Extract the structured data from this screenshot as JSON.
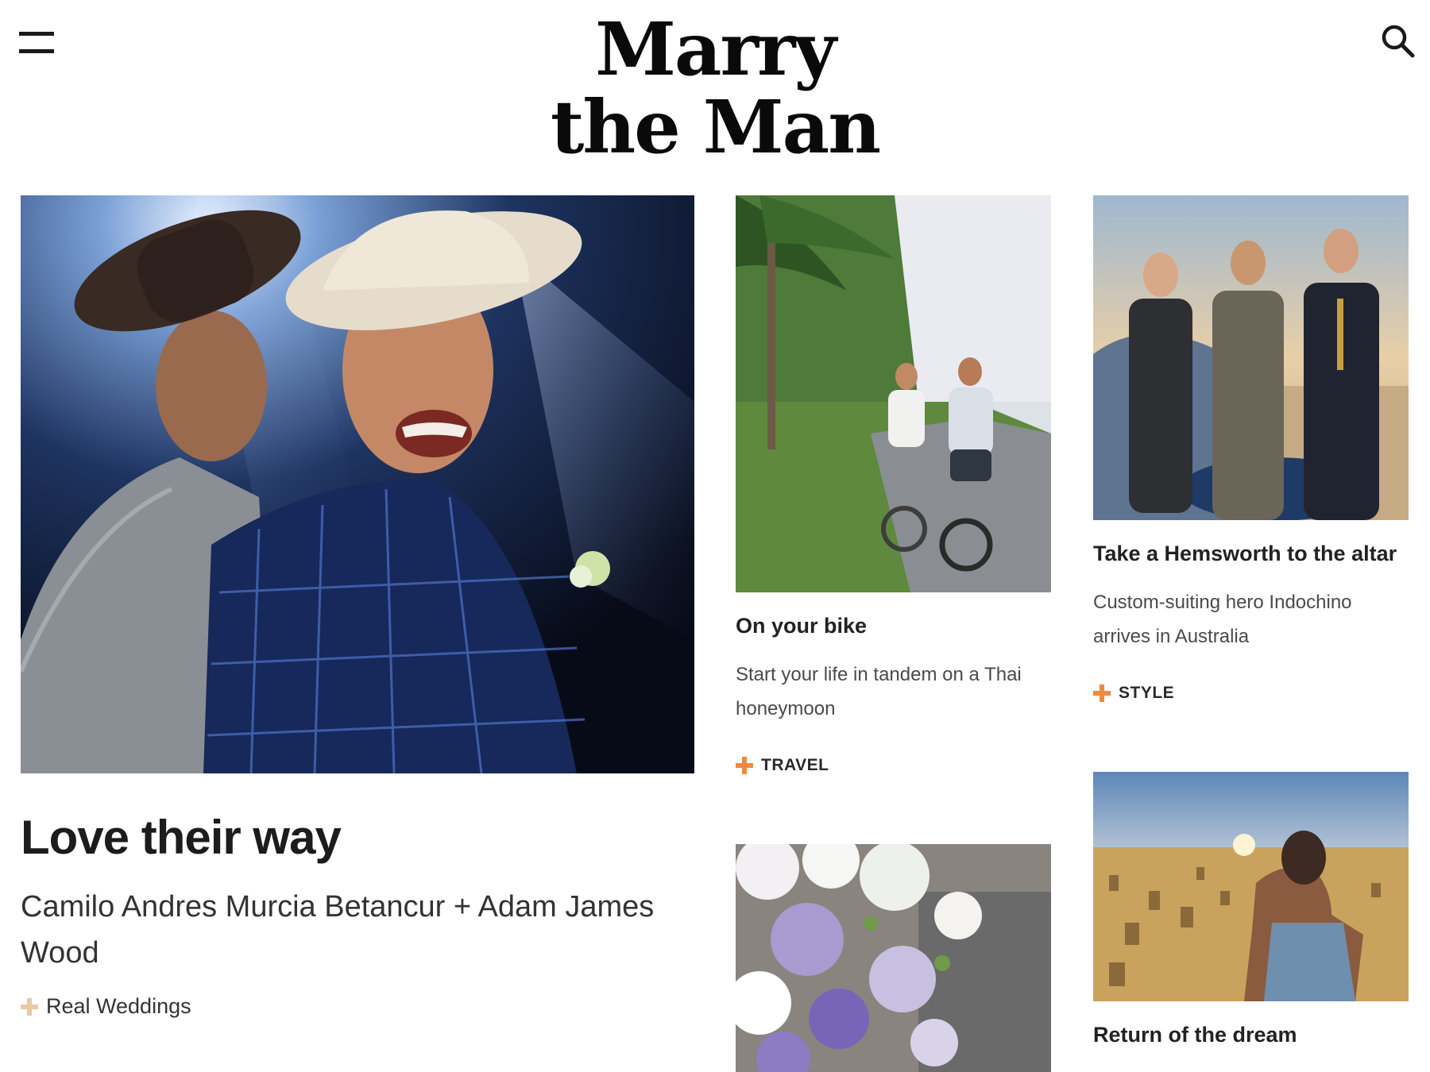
{
  "header": {
    "logo_line1": "Marry",
    "logo_line2": "the Man",
    "menu_icon": "hamburger-menu-icon",
    "search_icon": "search-icon"
  },
  "hero": {
    "title": "Love their way",
    "subtitle": "Camilo Andres Murcia Betancur + Adam James Wood",
    "category": "Real Weddings",
    "category_color": "#e8c9a6"
  },
  "cards": [
    {
      "title": "On your bike",
      "description": "Start your life in tandem on a Thai honeymoon",
      "category": "TRAVEL",
      "category_color": "#ee8a3c"
    },
    {
      "title": "Take a Hemsworth to the altar",
      "description": "Custom-suiting hero Indochino arrives in Australia",
      "category": "STYLE",
      "category_color": "#ee8a3c"
    },
    {
      "title": "Return of the dream"
    }
  ],
  "colors": {
    "accent": "#ee8a3c",
    "text": "#1a1a1a",
    "background": "#ffffff"
  }
}
